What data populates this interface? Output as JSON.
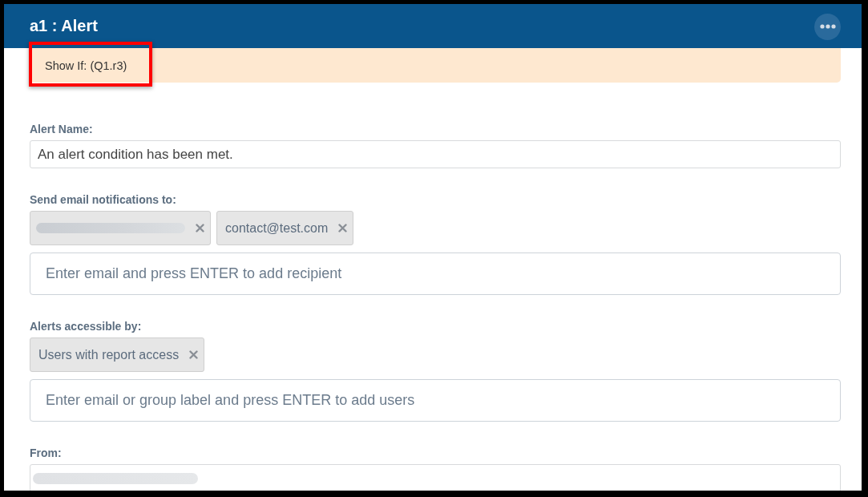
{
  "panel": {
    "title": "a1 : Alert"
  },
  "condition": {
    "text": "Show If: (Q1.r3)",
    "highlighted": true
  },
  "fields": [
    {
      "kind": "text",
      "label": "Alert Name:",
      "value": "An alert condition has been met.",
      "redacted": false
    },
    {
      "kind": "tags",
      "label": "Send email notifications to:",
      "tags": [
        {
          "redacted": true
        },
        {
          "text": "contact@test.com",
          "redacted": false
        }
      ],
      "placeholder": "Enter email and press ENTER to add recipient"
    },
    {
      "kind": "tags",
      "label": "Alerts accessible by:",
      "tags": [
        {
          "text": "Users with report access",
          "redacted": false
        }
      ],
      "placeholder": "Enter email or group label and press ENTER to add users"
    },
    {
      "kind": "text",
      "label": "From:",
      "redacted": true
    }
  ]
}
